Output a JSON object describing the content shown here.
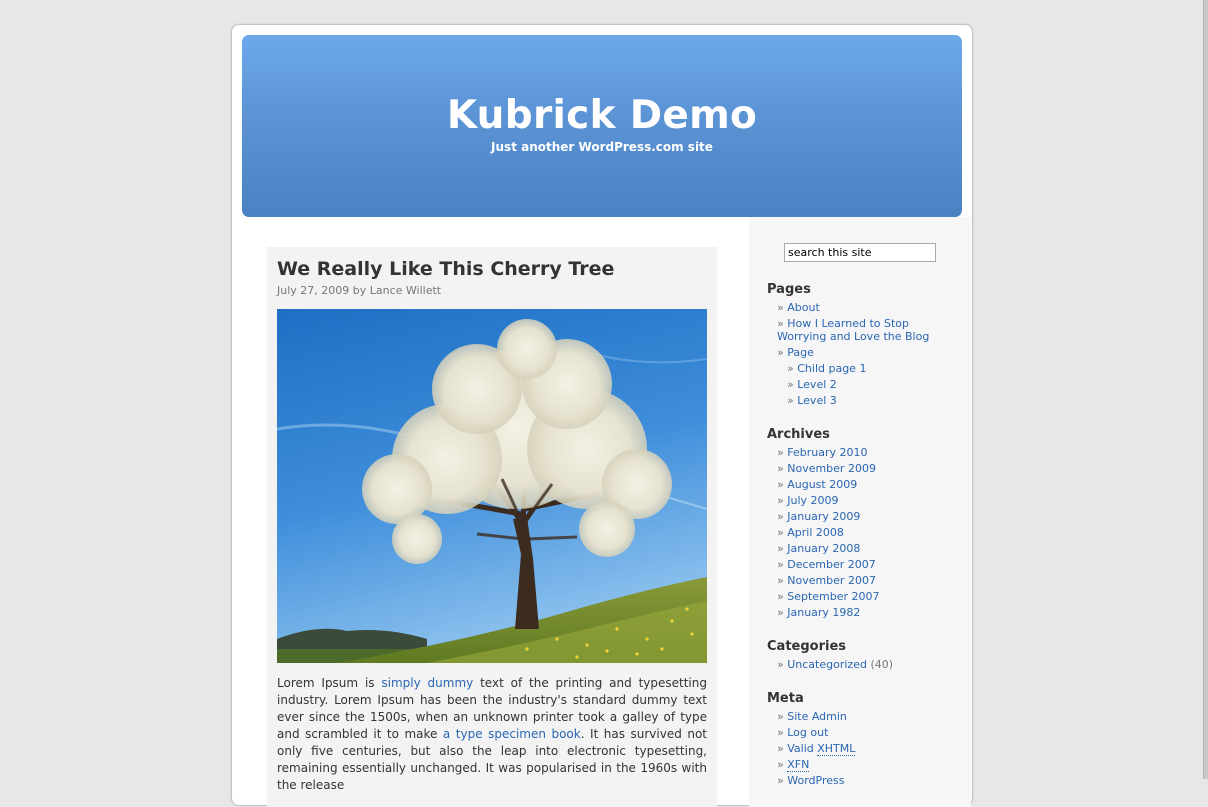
{
  "header": {
    "site_title": "Kubrick Demo",
    "site_description": "Just another WordPress.com site"
  },
  "post": {
    "title": "We Really Like This Cherry Tree",
    "meta": "July 27, 2009 by Lance Willett",
    "image_alt": "Blooming cherry tree on a grassy hillside under a blue sky",
    "body": {
      "t1": "Lorem Ipsum is ",
      "link1": "simply dummy",
      "t2": " text of the printing and typesetting industry. Lorem Ipsum has been the industry's standard dummy text ever since the 1500s, when an unknown printer took a galley of type and scrambled it to make ",
      "link2": "a type specimen book",
      "t3": ". It has survived not only five centuries, but also the leap into electronic typesetting, remaining essentially unchanged. It was popularised in the 1960s with the release"
    }
  },
  "sidebar": {
    "search_value": "search this site",
    "pages": {
      "title": "Pages",
      "items": [
        "About",
        "How I Learned to Stop Worrying and Love the Blog",
        "Page"
      ],
      "subitems": [
        "Child page 1",
        "Level 2",
        "Level 3"
      ]
    },
    "archives": {
      "title": "Archives",
      "items": [
        "February 2010",
        "November 2009",
        "August 2009",
        "July 2009",
        "January 2009",
        "April 2008",
        "January 2008",
        "December 2007",
        "November 2007",
        "September 2007",
        "January 1982"
      ]
    },
    "categories": {
      "title": "Categories",
      "items": [
        {
          "label": "Uncategorized",
          "count": "(40)"
        }
      ]
    },
    "meta": {
      "title": "Meta",
      "items": [
        "Site Admin",
        "Log out"
      ],
      "valid_prefix": "Valid ",
      "valid_abbr": "XHTML",
      "xfn": "XFN",
      "wordpress": "WordPress"
    }
  },
  "colors": {
    "background": "#e7e7e7",
    "header_gradient_top": "#6ca9ea",
    "header_gradient_bottom": "#4982c2",
    "link": "#2a66b3",
    "text": "#333333"
  }
}
